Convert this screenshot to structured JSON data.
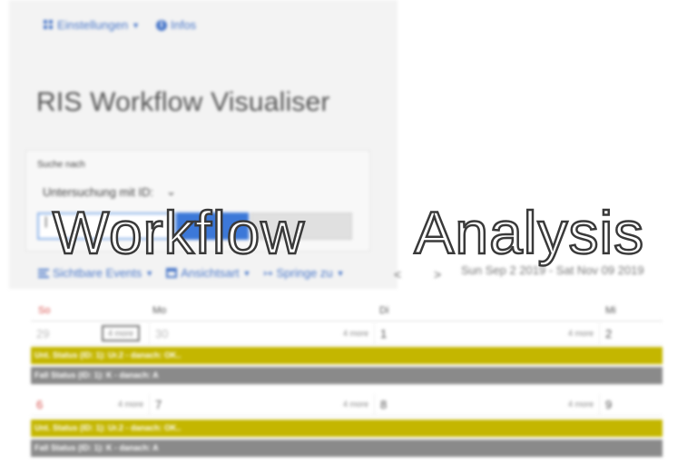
{
  "topnav": {
    "settings_label": "Einstellungen",
    "info_label": "Infos"
  },
  "app": {
    "title": "RIS Workflow Visualiser"
  },
  "search": {
    "label": "Suche nach",
    "select_value": "Untersuchung mit ID:",
    "input_value": "|"
  },
  "toolbar": {
    "events_label": "Sichtbare Events",
    "view_label": "Ansichtsart",
    "jump_label": "Springe zu",
    "prev": "<",
    "next": ">",
    "date_range": "Sun Sep 2 2019 - Sat Nov 09 2019"
  },
  "calendar": {
    "headers": [
      "So",
      "Mo",
      "Di",
      "Mi"
    ],
    "weeks": [
      {
        "days": [
          {
            "num": "29",
            "more": "4 more"
          },
          {
            "num": "30",
            "more": "4 more"
          },
          {
            "num": "1",
            "more": "4 more"
          },
          {
            "num": "2",
            "more": ""
          }
        ],
        "events": [
          {
            "label": "Unt. Status (ID: 1): Ur.2 - danach: OK.."
          },
          {
            "label": "Fall Status (ID: 1): K - danach: A"
          }
        ]
      },
      {
        "days": [
          {
            "num": "6",
            "more": "4 more"
          },
          {
            "num": "7",
            "more": "4 more"
          },
          {
            "num": "8",
            "more": "4 more"
          },
          {
            "num": "9",
            "more": ""
          }
        ],
        "events": [
          {
            "label": "Unt. Status (ID: 1): Ur.2 - danach: OK.."
          },
          {
            "label": "Fall Status (ID: 1): K - danach: A"
          }
        ]
      }
    ]
  },
  "overlay": {
    "title": "Workflow   Analysis"
  },
  "colors": {
    "accent": "#4a78c9",
    "event_unt": "#c4b600",
    "event_fall": "#8a8a8a",
    "sunday": "#d9534f"
  }
}
